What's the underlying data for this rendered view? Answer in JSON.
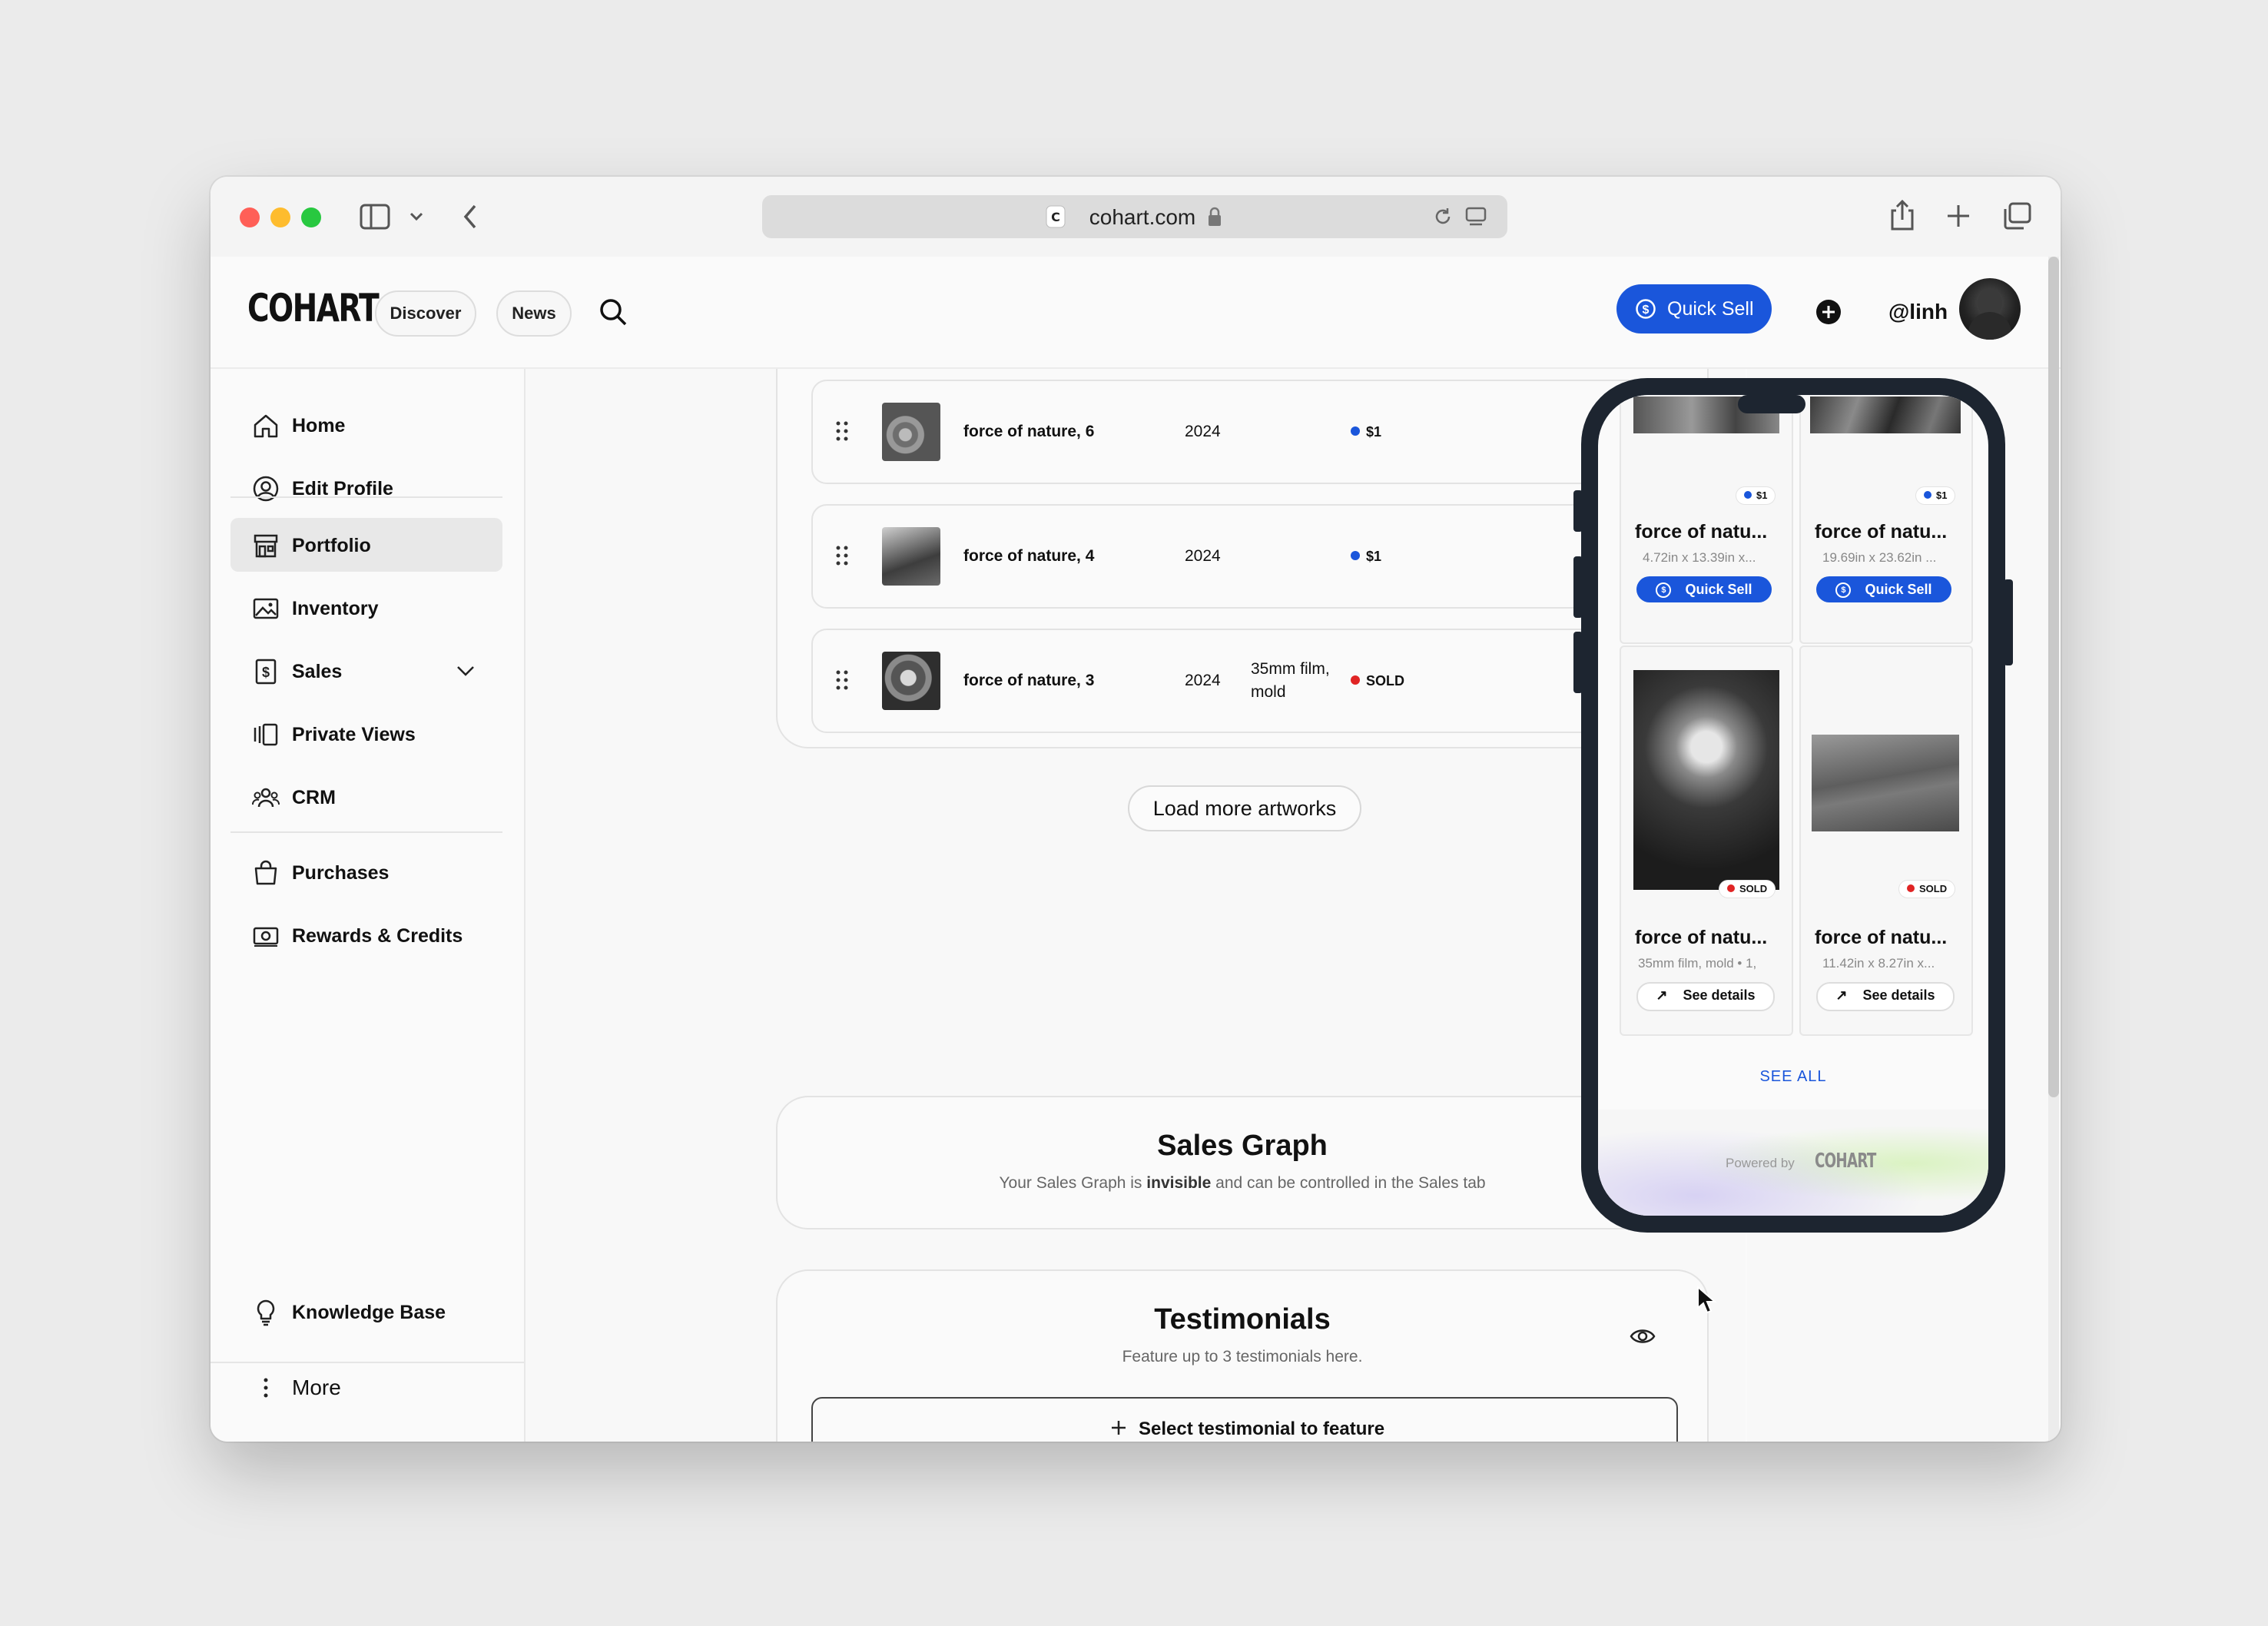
{
  "browser": {
    "url": "cohart.com"
  },
  "header": {
    "logo": "COHART",
    "nav": [
      "Discover",
      "News"
    ],
    "quick_sell_label": "Quick Sell",
    "username": "@linh"
  },
  "sidebar": {
    "items": [
      {
        "label": "Home",
        "icon": "home-icon"
      },
      {
        "label": "Edit Profile",
        "icon": "user-circle-icon"
      },
      {
        "label": "Portfolio",
        "icon": "storefront-icon",
        "active": true
      },
      {
        "label": "Inventory",
        "icon": "image-icon"
      },
      {
        "label": "Sales",
        "icon": "dollar-receipt-icon"
      },
      {
        "label": "Private Views",
        "icon": "gallery-views-icon"
      },
      {
        "label": "CRM",
        "icon": "users-icon"
      },
      {
        "label": "Purchases",
        "icon": "shopping-bag-icon"
      },
      {
        "label": "Rewards & Credits",
        "icon": "cash-icon"
      }
    ],
    "knowledge_base": "Knowledge Base",
    "more": "More"
  },
  "artworks": {
    "rows": [
      {
        "title": "force of nature, 6",
        "year": "2024",
        "medium": "",
        "status": "$1",
        "status_color": "#1a56db"
      },
      {
        "title": "force of nature, 4",
        "year": "2024",
        "medium": "",
        "status": "$1",
        "status_color": "#1a56db"
      },
      {
        "title": "force of nature, 3",
        "year": "2024",
        "medium": "35mm film, mold",
        "status": "SOLD",
        "status_color": "#e02424"
      }
    ],
    "load_more": "Load more artworks"
  },
  "sales_graph": {
    "title": "Sales Graph",
    "sub_before": "Your Sales Graph is ",
    "sub_bold": "invisible",
    "sub_after": " and can be controlled in the Sales tab"
  },
  "testimonials": {
    "title": "Testimonials",
    "subtitle": "Feature up to 3 testimonials here.",
    "select_label": "Select testimonial to feature"
  },
  "phone_preview": {
    "cards": [
      {
        "name": "force of natu...",
        "dims": "4.72in x 13.39in x...",
        "tag": "$1",
        "button": "Quick Sell"
      },
      {
        "name": "force of natu...",
        "dims": "19.69in x 23.62in ...",
        "tag": "$1",
        "button": "Quick Sell"
      },
      {
        "name": "force of natu...",
        "dims": "35mm film, mold  •  1,",
        "tag": "SOLD",
        "button": "See details"
      },
      {
        "name": "force of natu...",
        "dims": "11.42in x 8.27in x...",
        "tag": "SOLD",
        "button": "See details"
      }
    ],
    "see_all": "SEE ALL",
    "powered_by": "Powered by",
    "powered_logo": "COHART"
  },
  "colors": {
    "accent": "#1a56db",
    "sold": "#e02424",
    "phone_frame": "#1d2530"
  }
}
